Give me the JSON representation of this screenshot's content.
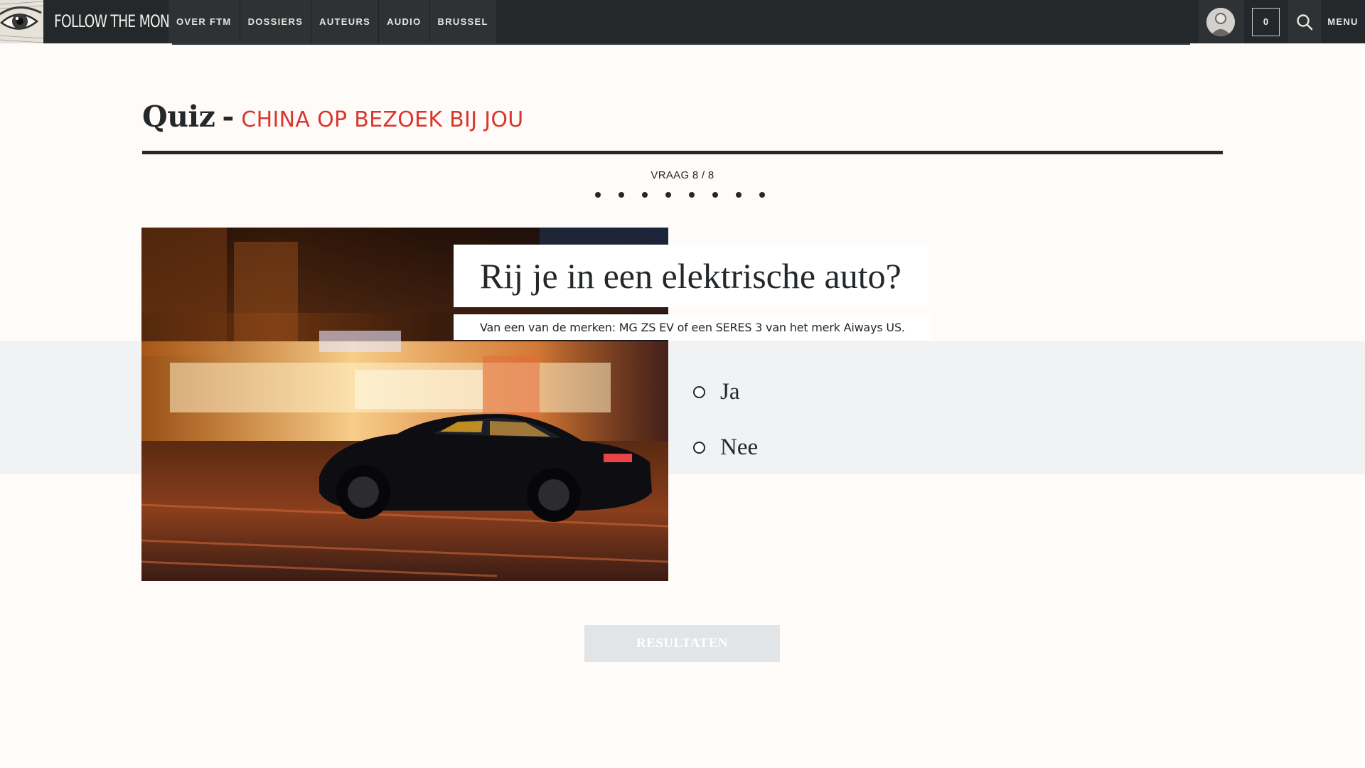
{
  "header": {
    "logo_text": "FOLLOW THE MONEY",
    "nav": [
      "OVER FTM",
      "DOSSIERS",
      "AUTEURS",
      "AUDIO",
      "BRUSSEL"
    ],
    "cart_count": "0",
    "menu_label": "MENU",
    "icons": {
      "logo": "eye-logo-icon",
      "avatar": "user-avatar-icon",
      "search": "search-icon"
    }
  },
  "quiz": {
    "label": "Quiz",
    "separator": "-",
    "subject": "CHINA OP BEZOEK BIJ JOU",
    "progress": "VRAAG 8 / 8",
    "current_question": 8,
    "total_questions": 8,
    "question": "Rij je in een elektrische auto?",
    "hint": "Van een van de merken: MG ZS EV of een SERES 3 van het merk Aiways US.",
    "options": [
      "Ja",
      "Nee"
    ],
    "results_label": "RESULTATEN"
  },
  "colors": {
    "topbar": "#24282b",
    "accent": "#d9362e",
    "text": "#24282b",
    "background": "#fffbf8",
    "button_disabled": "#e1e5e8"
  }
}
